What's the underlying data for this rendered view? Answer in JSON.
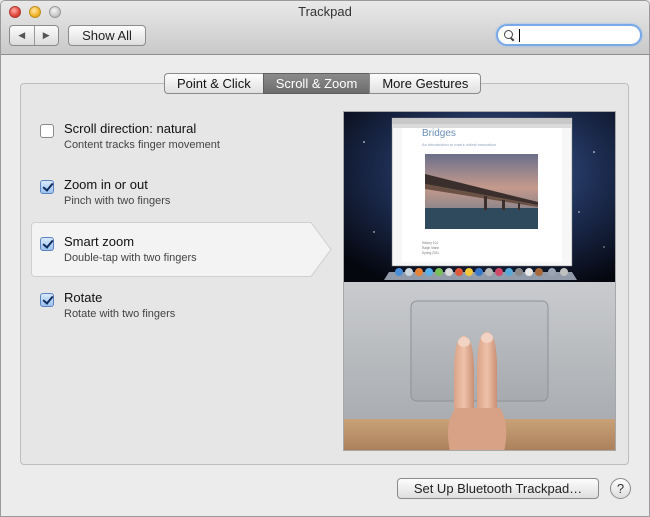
{
  "window": {
    "title": "Trackpad"
  },
  "toolbar": {
    "back_glyph": "◀",
    "forward_glyph": "▶",
    "show_all_label": "Show All",
    "search_placeholder": ""
  },
  "tabs": [
    {
      "label": "Point & Click",
      "active": false
    },
    {
      "label": "Scroll & Zoom",
      "active": true
    },
    {
      "label": "More Gestures",
      "active": false
    }
  ],
  "options": [
    {
      "title": "Scroll direction: natural",
      "subtitle": "Content tracks finger movement",
      "checked": false
    },
    {
      "title": "Zoom in or out",
      "subtitle": "Pinch with two fingers",
      "checked": true
    },
    {
      "title": "Smart zoom",
      "subtitle": "Double-tap with two fingers",
      "checked": true,
      "selected": true
    },
    {
      "title": "Rotate",
      "subtitle": "Rotate with two fingers",
      "checked": true
    }
  ],
  "preview": {
    "doc_title": "Bridges",
    "doc_subtitle": "An introduction to man's oldest innovation",
    "doc_meta": [
      "History 101",
      "Ralph Mann",
      "Spring 2011"
    ]
  },
  "footer": {
    "bluetooth_button_label": "Set Up Bluetooth Trackpad…",
    "help_label": "?"
  },
  "colors": {
    "active_tab": "#777777",
    "checkbox_blue": "#9dc1ef",
    "search_focus": "#7aa9e8"
  }
}
